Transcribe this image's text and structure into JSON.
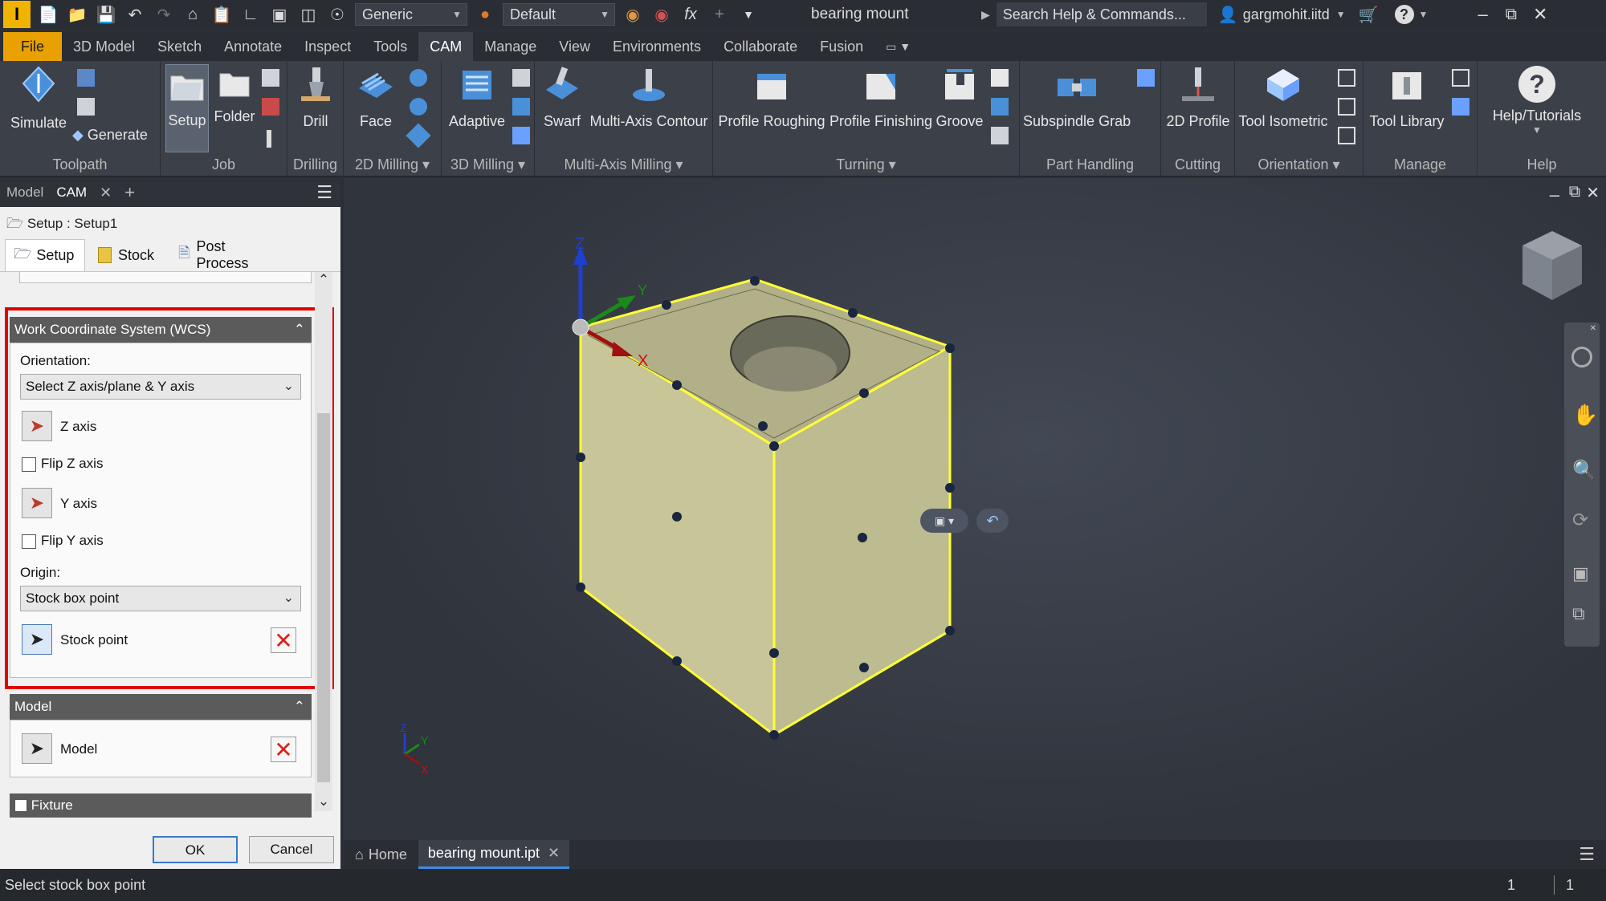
{
  "titlebar": {
    "app_logo": "I",
    "appearance_combo": "Generic",
    "material_combo": "Default",
    "fx_label": "fx",
    "document_title": "bearing mount",
    "search_placeholder": "Search Help & Commands...",
    "user": "gargmohit.iitd"
  },
  "menu": {
    "tabs": [
      "File",
      "3D Model",
      "Sketch",
      "Annotate",
      "Inspect",
      "Tools",
      "CAM",
      "Manage",
      "View",
      "Environments",
      "Collaborate",
      "Fusion"
    ],
    "active": "CAM"
  },
  "ribbon": {
    "simulate": "Simulate",
    "generate": "Generate",
    "setup": "Setup",
    "folder": "Folder",
    "drill": "Drill",
    "face": "Face",
    "adaptive": "Adaptive",
    "swarf": "Swarf",
    "multi_axis_contour": "Multi-Axis Contour",
    "profile_roughing": "Profile Roughing",
    "profile_finishing": "Profile Finishing",
    "groove": "Groove",
    "subspindle_grab": "Subspindle Grab",
    "profile_2d": "2D Profile",
    "tool_isometric": "Tool Isometric",
    "tool_library": "Tool Library",
    "help_tutorials": "Help/Tutorials",
    "groups": {
      "toolpath": "Toolpath",
      "job": "Job",
      "drilling": "Drilling",
      "milling_2d": "2D Milling",
      "milling_3d": "3D Milling",
      "multi_axis": "Multi-Axis Milling",
      "turning": "Turning",
      "part_handling": "Part Handling",
      "cutting": "Cutting",
      "orientation": "Orientation",
      "manage": "Manage",
      "help": "Help"
    }
  },
  "browser_tabs": {
    "model": "Model",
    "cam": "CAM",
    "add": "+"
  },
  "dialog": {
    "title": "Setup : Setup1",
    "tabs": [
      "Setup",
      "Stock",
      "Post Process"
    ],
    "wcs": {
      "header": "Work Coordinate System (WCS)",
      "orientation_label": "Orientation:",
      "orientation_value": "Select Z axis/plane & Y axis",
      "z_axis": "Z axis",
      "flip_z": "Flip Z axis",
      "y_axis": "Y axis",
      "flip_y": "Flip Y axis",
      "origin_label": "Origin:",
      "origin_value": "Stock box point",
      "stock_point": "Stock point"
    },
    "model_section": {
      "header": "Model",
      "model": "Model"
    },
    "fixture": "Fixture",
    "ok": "OK",
    "cancel": "Cancel"
  },
  "viewport": {
    "axis_x": "X",
    "axis_y": "Y",
    "axis_z": "Z",
    "highlight_color": "#ffff33"
  },
  "doc_tabs": {
    "home": "Home",
    "file": "bearing mount.ipt"
  },
  "status": {
    "message": "Select stock box point",
    "count1": "1",
    "count2": "1"
  }
}
